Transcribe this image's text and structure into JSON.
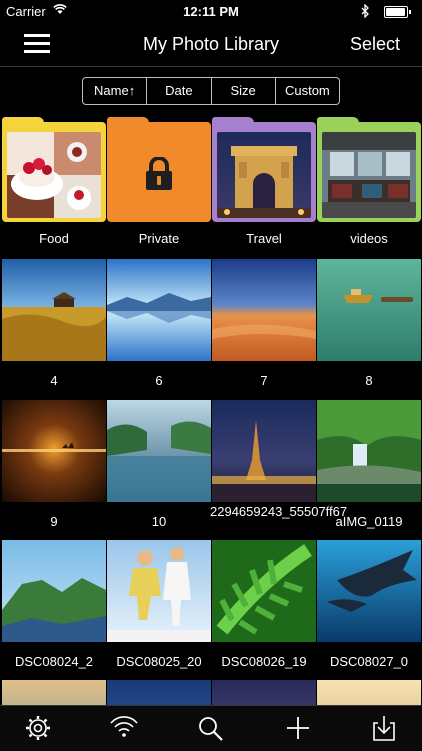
{
  "status": {
    "carrier": "Carrier",
    "time": "12:11 PM"
  },
  "navbar": {
    "title": "My Photo Library",
    "select_label": "Select",
    "menu_icon": "hamburger-menu-icon"
  },
  "sort": {
    "options": [
      "Name↑",
      "Date",
      "Size",
      "Custom"
    ],
    "selected": "Name↑"
  },
  "folders": [
    {
      "name": "Food",
      "color": "#f5d33a"
    },
    {
      "name": "Private",
      "color": "#f08a2a"
    },
    {
      "name": "Travel",
      "color": "#a77fcf"
    },
    {
      "name": "videos",
      "color": "#9ad15a"
    }
  ],
  "photos": [
    [
      "4",
      "6",
      "7",
      "8"
    ],
    [
      "9",
      "10",
      "2294659243_55507ff67",
      "aIMG_0119"
    ],
    [
      "DSC08024_2",
      "DSC08025_20",
      "DSC08026_19",
      "DSC08027_0"
    ]
  ],
  "toolbar": {
    "icons": [
      "gear-icon",
      "wifi-icon",
      "search-icon",
      "plus-icon",
      "import-icon"
    ]
  }
}
